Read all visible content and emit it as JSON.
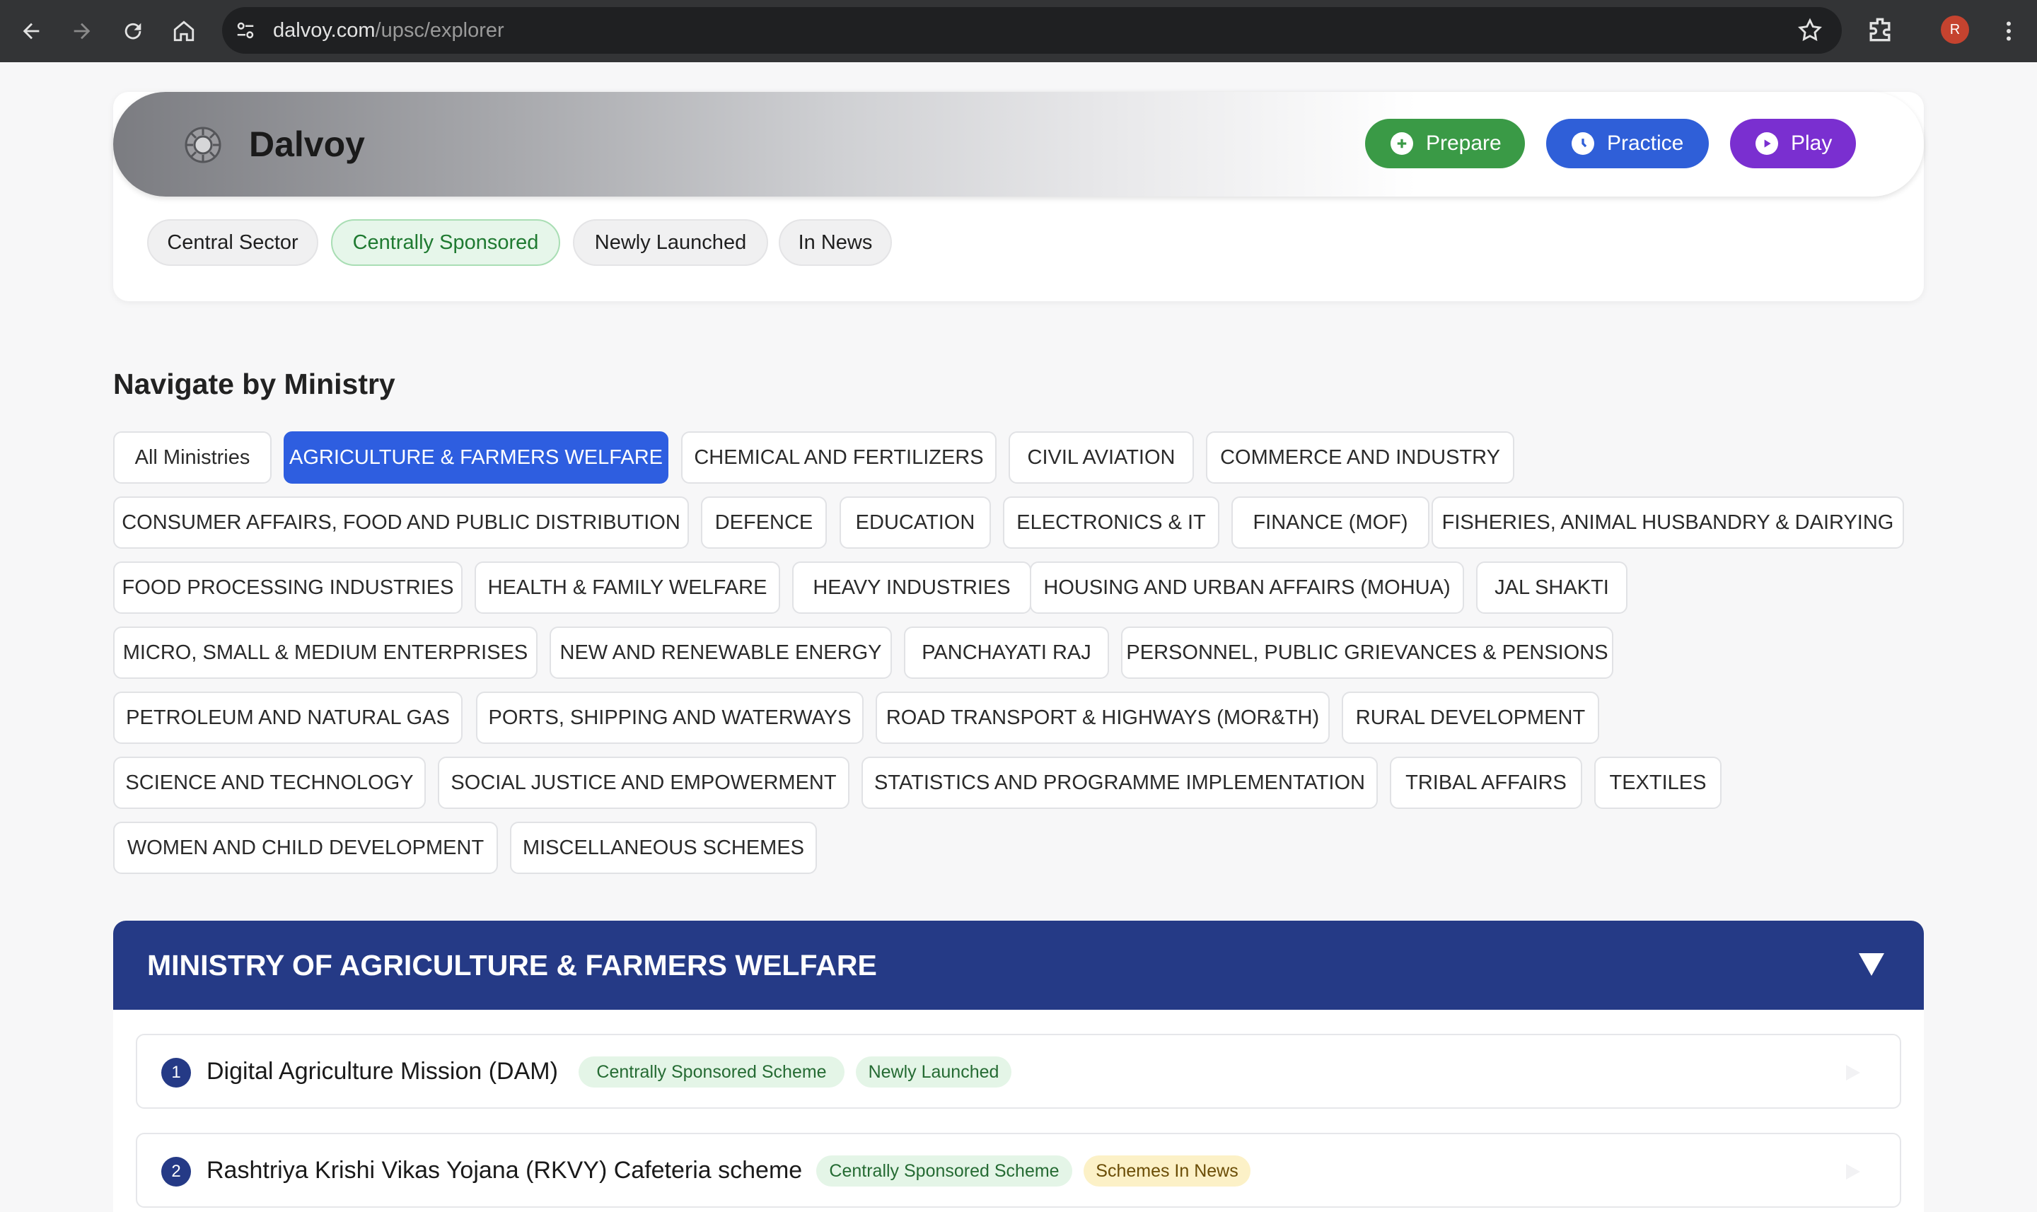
{
  "browser": {
    "url_domain": "dalvoy.com",
    "url_path": "/upsc/explorer",
    "profile_initial": "R"
  },
  "header": {
    "brand": "Dalvoy",
    "buttons": {
      "prepare": "Prepare",
      "practice": "Practice",
      "play": "Play"
    },
    "colors": {
      "prepare": "#3a9a46",
      "practice": "#2f5fd8",
      "play": "#7a2fd0"
    }
  },
  "categories": [
    "Central Sector",
    "Centrally Sponsored",
    "Newly Launched",
    "In News"
  ],
  "active_category": "Centrally Sponsored",
  "ministry_nav": {
    "title": "Navigate by Ministry",
    "chips": [
      "All Ministries",
      "AGRICULTURE & FARMERS WELFARE",
      "CHEMICAL AND FERTILIZERS",
      "CIVIL AVIATION",
      "COMMERCE AND INDUSTRY",
      "CONSUMER AFFAIRS, FOOD AND PUBLIC DISTRIBUTION",
      "DEFENCE",
      "EDUCATION",
      "ELECTRONICS & IT",
      "FINANCE (MOF)",
      "FISHERIES, ANIMAL HUSBANDRY & DAIRYING",
      "FOOD PROCESSING INDUSTRIES",
      "HEALTH & FAMILY WELFARE",
      "HEAVY INDUSTRIES",
      "HOUSING AND URBAN AFFAIRS (MOHUA)",
      "JAL SHAKTI",
      "MICRO, SMALL & MEDIUM ENTERPRISES",
      "NEW AND RENEWABLE ENERGY",
      "PANCHAYATI RAJ",
      "PERSONNEL, PUBLIC GRIEVANCES & PENSIONS",
      "PETROLEUM AND NATURAL GAS",
      "PORTS, SHIPPING AND WATERWAYS",
      "ROAD TRANSPORT & HIGHWAYS (MOR&TH)",
      "RURAL DEVELOPMENT",
      "SCIENCE AND TECHNOLOGY",
      "SOCIAL JUSTICE AND EMPOWERMENT",
      "STATISTICS AND PROGRAMME IMPLEMENTATION",
      "TRIBAL AFFAIRS",
      "TEXTILES",
      "WOMEN AND CHILD DEVELOPMENT",
      "MISCELLANEOUS SCHEMES"
    ],
    "active": "AGRICULTURE & FARMERS WELFARE"
  },
  "ministry_panel": {
    "title": "MINISTRY OF AGRICULTURE & FARMERS WELFARE",
    "schemes": [
      {
        "num": "1",
        "name": "Digital Agriculture Mission (DAM)",
        "tags": [
          {
            "label": "Centrally Sponsored Scheme",
            "color": "green"
          },
          {
            "label": "Newly Launched",
            "color": "green"
          }
        ]
      },
      {
        "num": "2",
        "name": "Rashtriya Krishi Vikas Yojana (RKVY) Cafeteria scheme",
        "tags": [
          {
            "label": "Centrally Sponsored Scheme",
            "color": "green"
          },
          {
            "label": "Schemes In News",
            "color": "yellow"
          }
        ]
      }
    ]
  }
}
